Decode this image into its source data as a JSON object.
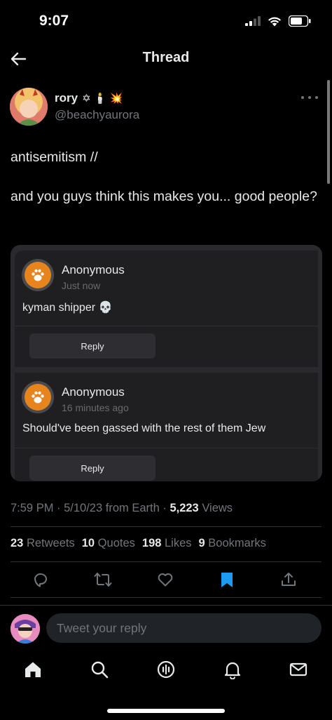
{
  "status_bar": {
    "time": "9:07"
  },
  "nav": {
    "title": "Thread"
  },
  "tweet": {
    "author_name": "rory",
    "author_emoji": "✡ 🕯️ 💥",
    "author_handle": "@beachyaurora",
    "text": "antisemitism //\n\nand you guys think this makes you... good people?",
    "timestamp": "7:59 PM · 5/10/23 from Earth · ",
    "views_count": "5,223",
    "views_label": " Views"
  },
  "embed": {
    "items": [
      {
        "name": "Anonymous",
        "time": "Just now",
        "message": "kyman shipper 💀",
        "reply_label": "Reply"
      },
      {
        "name": "Anonymous",
        "time": "16 minutes ago",
        "message": "Should've been gassed with the rest of them Jew",
        "reply_label": "Reply"
      }
    ]
  },
  "stats": {
    "retweets_count": "23",
    "retweets_label": " Retweets",
    "quotes_count": "10",
    "quotes_label": " Quotes",
    "likes_count": "198",
    "likes_label": " Likes",
    "bookmarks_count": "9",
    "bookmarks_label": " Bookmarks"
  },
  "actions": [
    "reply-icon",
    "retweet-icon",
    "like-icon",
    "bookmark-icon",
    "share-icon"
  ],
  "reply_bar": {
    "placeholder": "Tweet your reply"
  },
  "tabbar": [
    "home-icon",
    "search-icon",
    "spaces-icon",
    "notifications-icon",
    "messages-icon"
  ],
  "colors": {
    "background": "#000000",
    "accent": "#1d9bf0",
    "embed_avatar": "#e8841e",
    "muted": "#71767b"
  }
}
